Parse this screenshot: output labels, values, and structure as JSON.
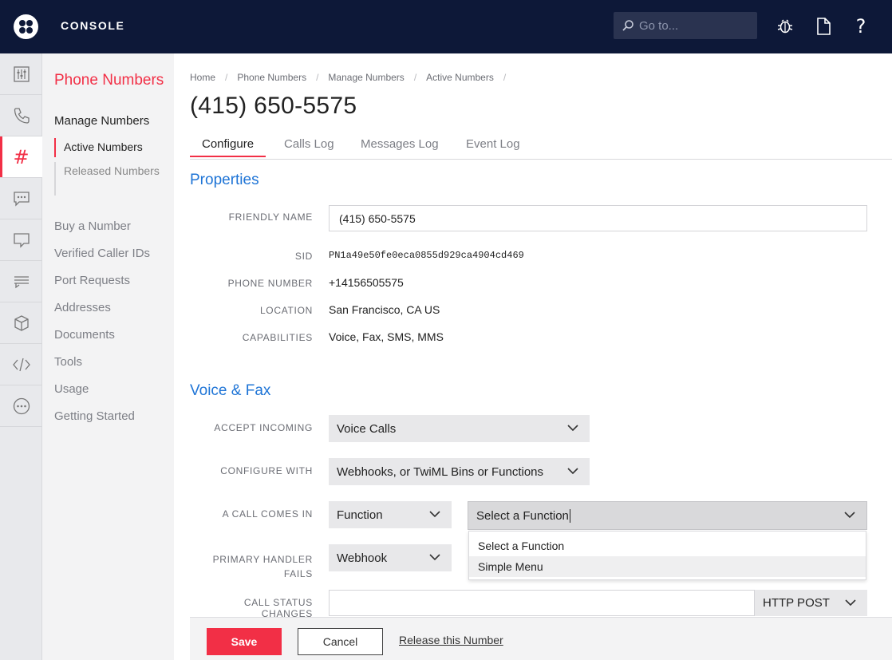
{
  "header": {
    "brand": "CONSOLE",
    "search_placeholder": "Go to...",
    "icons": [
      "bug-icon",
      "docs-icon",
      "help-icon"
    ],
    "help_label": "?"
  },
  "rail": {
    "items": [
      "dashboard-icon",
      "phone-icon",
      "hash-icon",
      "chat-icon",
      "messaging-icon",
      "list-icon",
      "cube-icon",
      "code-icon",
      "more-icon"
    ],
    "hash_label": "#"
  },
  "subnav": {
    "title": "Phone Numbers",
    "section": "Manage Numbers",
    "sub_items": [
      "Active Numbers",
      "Released Numbers"
    ],
    "links": [
      "Buy a Number",
      "Verified Caller IDs",
      "Port Requests",
      "Addresses",
      "Documents",
      "Tools",
      "Usage",
      "Getting Started"
    ]
  },
  "breadcrumb": [
    "Home",
    "Phone Numbers",
    "Manage Numbers",
    "Active Numbers"
  ],
  "page_title": "(415) 650-5575",
  "tabs": [
    "Configure",
    "Calls Log",
    "Messages Log",
    "Event Log"
  ],
  "properties": {
    "heading": "Properties",
    "friendly_name_label": "FRIENDLY NAME",
    "friendly_name_value": "(415) 650-5575",
    "sid_label": "SID",
    "sid_value": "PN1a49e50fe0eca0855d929ca4904cd469",
    "phone_label": "PHONE NUMBER",
    "phone_value": "+14156505575",
    "location_label": "LOCATION",
    "location_value": "San Francisco, CA US",
    "capabilities_label": "CAPABILITIES",
    "capabilities_value": "Voice, Fax, SMS, MMS"
  },
  "voice": {
    "heading": "Voice & Fax",
    "accept_label": "ACCEPT INCOMING",
    "accept_value": "Voice Calls",
    "configure_label": "CONFIGURE WITH",
    "configure_value": "Webhooks, or TwiML Bins or Functions",
    "call_in_label": "A CALL COMES IN",
    "call_in_type": "Function",
    "function_select": "Select a Function",
    "function_options": [
      "Select a Function",
      "Simple Menu"
    ],
    "fail_label_1": "PRIMARY HANDLER",
    "fail_label_2": "FAILS",
    "fail_type": "Webhook",
    "status_label": "CALL STATUS CHANGES",
    "status_method": "HTTP POST"
  },
  "footer": {
    "save": "Save",
    "cancel": "Cancel",
    "release": "Release this Number"
  },
  "colors": {
    "topbar": "#0d1838",
    "accent_red": "#f22f46",
    "link_blue": "#1e74d6"
  }
}
